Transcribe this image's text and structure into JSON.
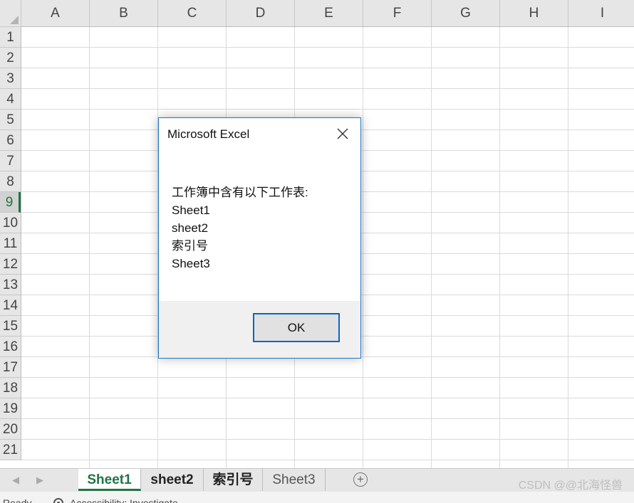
{
  "spreadsheet": {
    "columns": [
      "A",
      "B",
      "C",
      "D",
      "E",
      "F",
      "G",
      "H",
      "I"
    ],
    "rows": [
      "1",
      "2",
      "3",
      "4",
      "5",
      "6",
      "7",
      "8",
      "9",
      "10",
      "11",
      "12",
      "13",
      "14",
      "15",
      "16",
      "17",
      "18",
      "19",
      "20",
      "21"
    ],
    "selected_row": "9",
    "accent_color": "#217346"
  },
  "sheet_tabs": {
    "tabs": [
      {
        "label": "Sheet1",
        "state": "active"
      },
      {
        "label": "sheet2",
        "state": "bold"
      },
      {
        "label": "索引号",
        "state": "bold"
      },
      {
        "label": "Sheet3",
        "state": "normal"
      }
    ],
    "nav_prev_icon": "triangle-left-icon",
    "nav_next_icon": "triangle-right-icon",
    "add_sheet_icon": "plus-circle-icon"
  },
  "dialog": {
    "title": "Microsoft Excel",
    "message_lines": [
      "工作簿中含有以下工作表:",
      "Sheet1",
      "sheet2",
      "索引号",
      "Sheet3"
    ],
    "ok_label": "OK",
    "close_icon": "close-icon",
    "border_color": "#1f78c8"
  },
  "status_bar": {
    "ready_text": "Ready",
    "accessibility_text": "Accessibility: Investigate",
    "accessibility_icon": "accessibility-icon"
  },
  "watermark": "CSDN @@北海怪兽"
}
